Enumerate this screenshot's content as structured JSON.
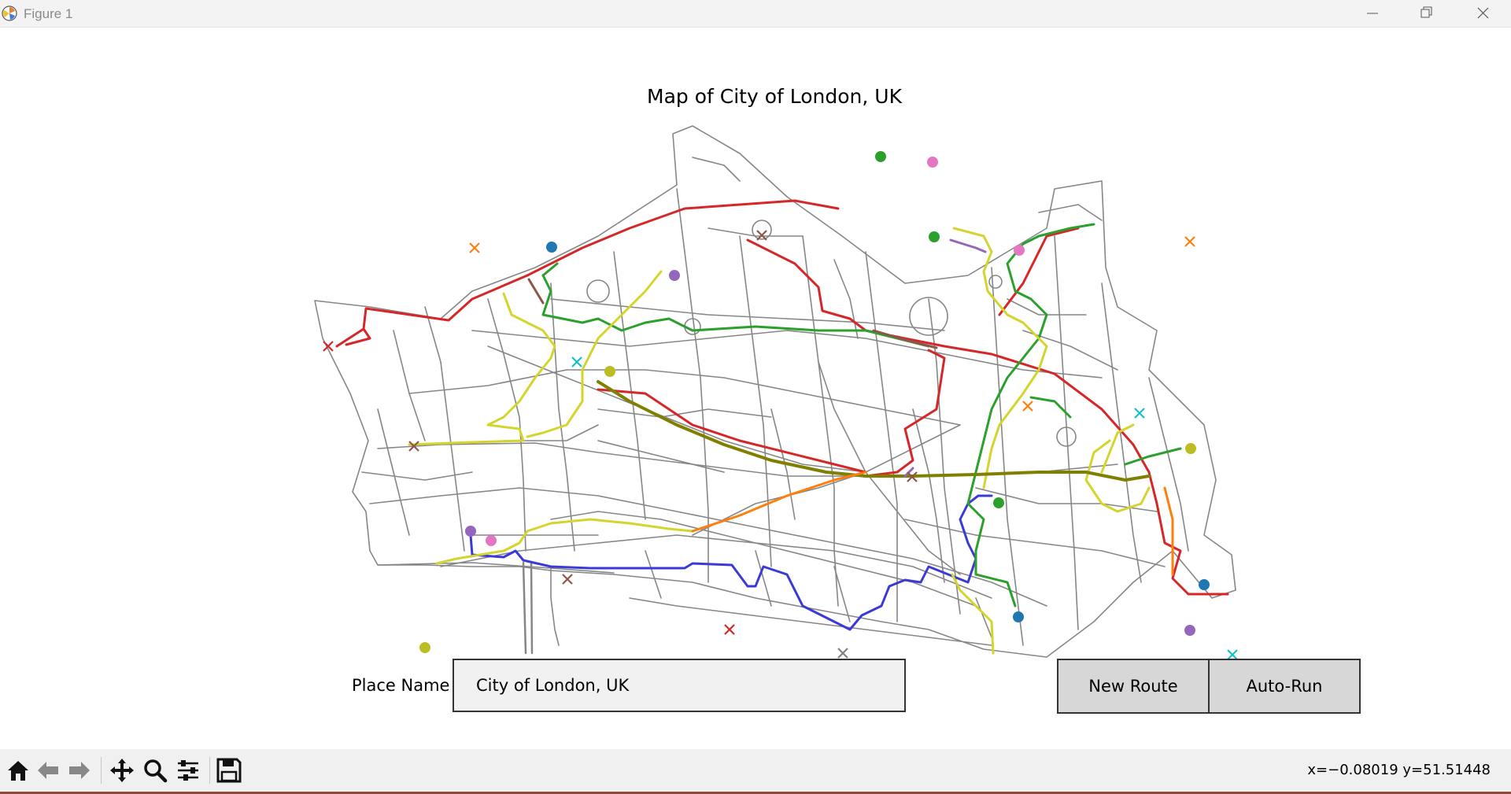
{
  "window": {
    "title": "Figure 1",
    "icons": {
      "app": "matplotlib-icon",
      "minimize": "minimize-icon",
      "restore": "restore-icon",
      "close": "close-icon"
    }
  },
  "plot": {
    "title": "Map of City of London, UK"
  },
  "controls": {
    "place_label": "Place Name",
    "place_value": "City of London, UK",
    "new_route_label": "New Route",
    "auto_run_label": "Auto-Run"
  },
  "toolbar": {
    "tools": [
      "home-icon",
      "back-icon",
      "forward-icon",
      "pan-icon",
      "zoom-icon",
      "configure-subplots-icon",
      "save-icon"
    ],
    "coords": "x=−0.08019 y=51.51448"
  },
  "colors": {
    "street": "#808080",
    "red": "#d62728",
    "blue": "#3a3ad6",
    "green": "#2ca02c",
    "yellow": "#d4d42e",
    "olive": "#808000",
    "orange": "#ff7f0e",
    "purple": "#9467bd",
    "pink": "#e377c2",
    "brown": "#8c564b",
    "cyan": "#17becf",
    "mpl_blue": "#1f77b4",
    "mpl_olive": "#bcbd22"
  },
  "map": {
    "route_start_markers": [
      {
        "color": "#2ca02c"
      },
      {
        "color": "#e377c2"
      },
      {
        "color": "#1f77b4"
      },
      {
        "color": "#9467bd"
      },
      {
        "color": "#2ca02c"
      },
      {
        "color": "#e377c2"
      },
      {
        "color": "#bcbd22"
      },
      {
        "color": "#bcbd22"
      },
      {
        "color": "#2ca02c"
      },
      {
        "color": "#9467bd"
      },
      {
        "color": "#e377c2"
      },
      {
        "color": "#1f77b4"
      },
      {
        "color": "#1f77b4"
      },
      {
        "color": "#bcbd22"
      },
      {
        "color": "#9467bd"
      }
    ],
    "route_end_markers": [
      {
        "color": "#ff7f0e"
      },
      {
        "color": "#d62728"
      },
      {
        "color": "#8c564b"
      },
      {
        "color": "#17becf"
      },
      {
        "color": "#8c564b"
      },
      {
        "color": "#ff7f0e"
      },
      {
        "color": "#17becf"
      },
      {
        "color": "#8c564b"
      },
      {
        "color": "#8c564b"
      },
      {
        "color": "#d62728"
      },
      {
        "color": "#7f7f7f"
      },
      {
        "color": "#17becf"
      },
      {
        "color": "#ff7f0e"
      }
    ]
  }
}
